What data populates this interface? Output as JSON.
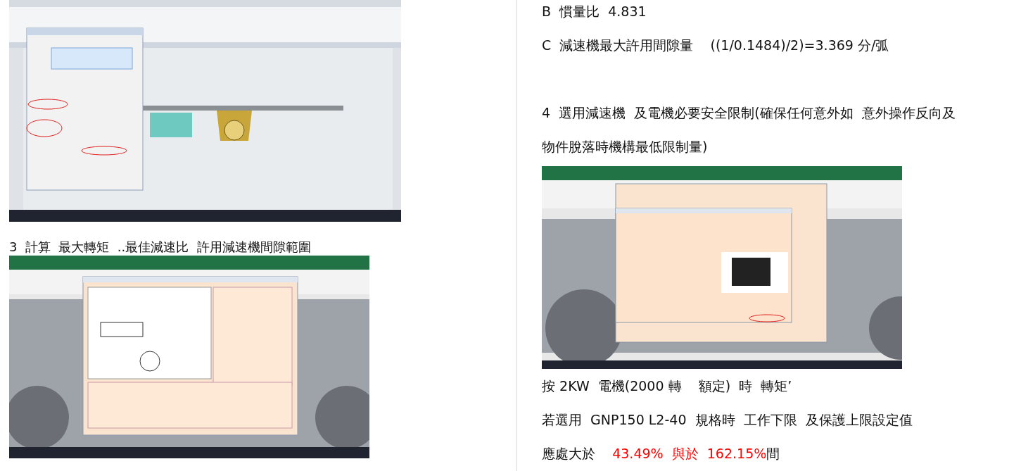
{
  "left_column": {
    "caption": "3  計算  最大轉矩  ..最佳減速比  許用減速機間隙範圍"
  },
  "right_column": {
    "paragraphs_top": [
      "B  慣量比  4.831",
      "C  減速機最大許用間隙量    ((1/0.1484)/2)=3.369 分/弧",
      "4  選用減速機  及電機必要安全限制(確保任何意外如  意外操作反向及",
      "物件脫落時機構最低限制量)"
    ],
    "paragraphs_bottom": [
      "按 2KW  電機(2000 轉    額定)  時  轉矩’",
      "若選用  GNP150 L2-40  規格時  工作下限  及保護上限設定值"
    ],
    "limit_sentence": {
      "parts": [
        {
          "text": "應處大於    ",
          "highlight": false
        },
        {
          "text": "43.49%  與於  162.15%",
          "highlight": true
        },
        {
          "text": "間",
          "highlight": false
        }
      ]
    }
  }
}
